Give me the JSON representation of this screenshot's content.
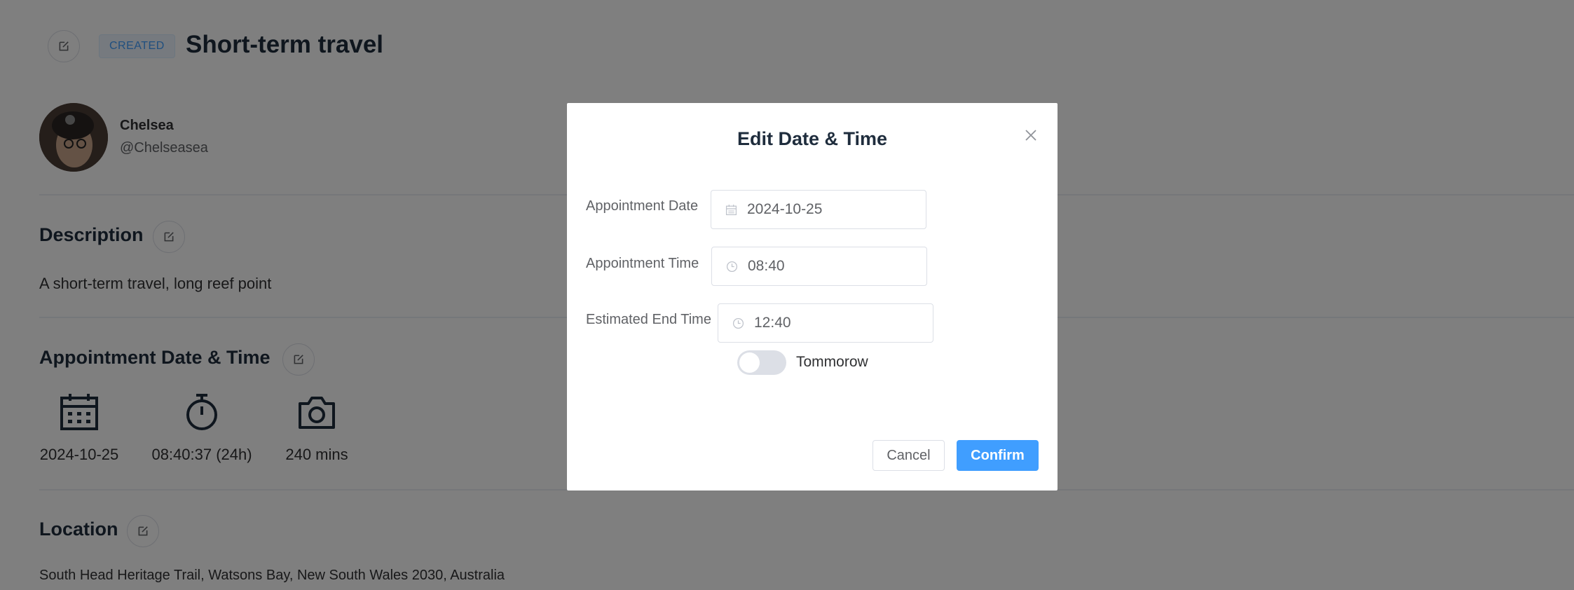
{
  "header": {
    "status_tag": "CREATED",
    "title": "Short-term travel"
  },
  "user": {
    "name": "Chelsea",
    "handle": "@Chelseasea"
  },
  "description": {
    "heading": "Description",
    "text": "A short-term travel, long reef point"
  },
  "appointment": {
    "heading": "Appointment Date & Time",
    "date": "2024-10-25",
    "time": "08:40:37 (24h)",
    "duration": "240 mins"
  },
  "location": {
    "heading": "Location",
    "address": "South Head Heritage Trail, Watsons Bay, New South Wales 2030, Australia"
  },
  "dialog": {
    "title": "Edit Date & Time",
    "date_label": "Appointment Date",
    "date_value": "2024-10-25",
    "time_label": "Appointment Time",
    "time_value": "08:40",
    "end_label": "Estimated End Time",
    "end_value": "12:40",
    "tomorrow_label": "Tommorow",
    "tomorrow_on": false,
    "cancel_label": "Cancel",
    "confirm_label": "Confirm"
  },
  "colors": {
    "primary": "#409eff",
    "overlay": "rgba(0,0,0,0.5)",
    "text": "#1f2d3d"
  }
}
